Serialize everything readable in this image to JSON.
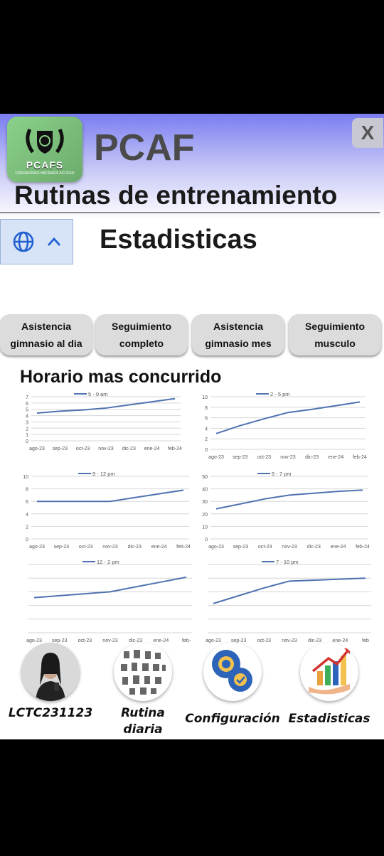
{
  "app": {
    "logo_text": "PCAFS",
    "logo_sub": "FORJADORES HACEMOS ACCESO",
    "title": "PCAF",
    "close_label": "X",
    "subtitle": "Rutinas de entrenamiento",
    "section_title": "Estadisticas"
  },
  "tabs": [
    {
      "line1": "Asistencia",
      "line2": "gimnasio al dia"
    },
    {
      "line1": "Seguimiento",
      "line2": "completo"
    },
    {
      "line1": "Asistencia",
      "line2": "gimnasio mes"
    },
    {
      "line1": "Seguimiento",
      "line2": "musculo"
    }
  ],
  "chart_heading": "Horario mas concurrido",
  "chart_data": [
    {
      "type": "line",
      "title": "",
      "categories": [
        "ago-23",
        "sep-23",
        "oct-23",
        "nov-23",
        "dic-23",
        "ene-24",
        "feb-24"
      ],
      "series": [
        {
          "name": "5 - 9 am",
          "values": [
            4.4,
            4.7,
            4.9,
            5.2,
            5.7,
            6.2,
            6.7
          ]
        }
      ],
      "ylim": [
        0,
        7
      ],
      "yticks": [
        "0",
        "1",
        "2",
        "3",
        "4",
        "5",
        "6",
        "7"
      ],
      "show_yticks": true,
      "grid": true
    },
    {
      "type": "line",
      "title": "",
      "categories": [
        "ago-23",
        "sep-23",
        "oct-23",
        "nov-23",
        "dic-23",
        "ene-24",
        "feb-24"
      ],
      "series": [
        {
          "name": "2 - 5 pm",
          "values": [
            3,
            4.5,
            5.8,
            7,
            7.6,
            8.3,
            9
          ]
        }
      ],
      "ylim": [
        0,
        10
      ],
      "yticks": [
        "0",
        "2",
        "4",
        "6",
        "8",
        "10"
      ],
      "show_yticks": true,
      "grid": true
    },
    {
      "type": "line",
      "title": "",
      "categories": [
        "ago-23",
        "sep-23",
        "oct-23",
        "nov-23",
        "dic-23",
        "ene-24",
        "feb-24"
      ],
      "series": [
        {
          "name": "9 - 12 pm",
          "values": [
            6,
            6,
            6,
            6,
            6.6,
            7.2,
            7.8
          ]
        }
      ],
      "ylim": [
        0,
        10
      ],
      "yticks": [
        "0",
        "2",
        "4",
        "6",
        "8",
        "10"
      ],
      "show_yticks": true,
      "grid": true
    },
    {
      "type": "line",
      "title": "",
      "categories": [
        "ago-23",
        "sep-23",
        "oct-23",
        "nov-23",
        "dic-23",
        "ene-24",
        "feb-24"
      ],
      "series": [
        {
          "name": "5 - 7 pm",
          "values": [
            24,
            28,
            32,
            35,
            36.5,
            38,
            39
          ]
        }
      ],
      "ylim": [
        0,
        50
      ],
      "yticks": [
        "0",
        "10",
        "20",
        "30",
        "40",
        "50"
      ],
      "show_yticks": true,
      "grid": true
    },
    {
      "type": "line",
      "title": "",
      "categories": [
        "ago-23",
        "sep-23",
        "oct-23",
        "nov-23",
        "dic-23",
        "ene-24",
        "feb-"
      ],
      "series": [
        {
          "name": "12 - 2 pm",
          "values": [
            7.2,
            7.6,
            8.0,
            8.4,
            9.4,
            10.4,
            11.4
          ]
        }
      ],
      "ylim": [
        0,
        14
      ],
      "yticks": [],
      "show_yticks": false,
      "grid": true
    },
    {
      "type": "line",
      "title": "",
      "categories": [
        "ago-23",
        "sep-23",
        "oct-23",
        "nov-23",
        "dic-23",
        "ene-24",
        "feb"
      ],
      "series": [
        {
          "name": "7 - 10 pm",
          "values": [
            6,
            7.6,
            9.2,
            10.6,
            10.8,
            11.0,
            11.2
          ]
        }
      ],
      "ylim": [
        0,
        14
      ],
      "yticks": [],
      "show_yticks": false,
      "grid": true
    }
  ],
  "nav": [
    {
      "label": "LCTC231123",
      "icon": "user-avatar"
    },
    {
      "label": "Rutina diaria",
      "icon": "exercise-poses-icon"
    },
    {
      "label": "Configuración",
      "icon": "gears-icon"
    },
    {
      "label": "Estadisticas",
      "icon": "growth-chart-icon"
    }
  ],
  "colors": {
    "series": "#4f72b0",
    "grid": "#d6d6d6",
    "tick": "#555555"
  }
}
